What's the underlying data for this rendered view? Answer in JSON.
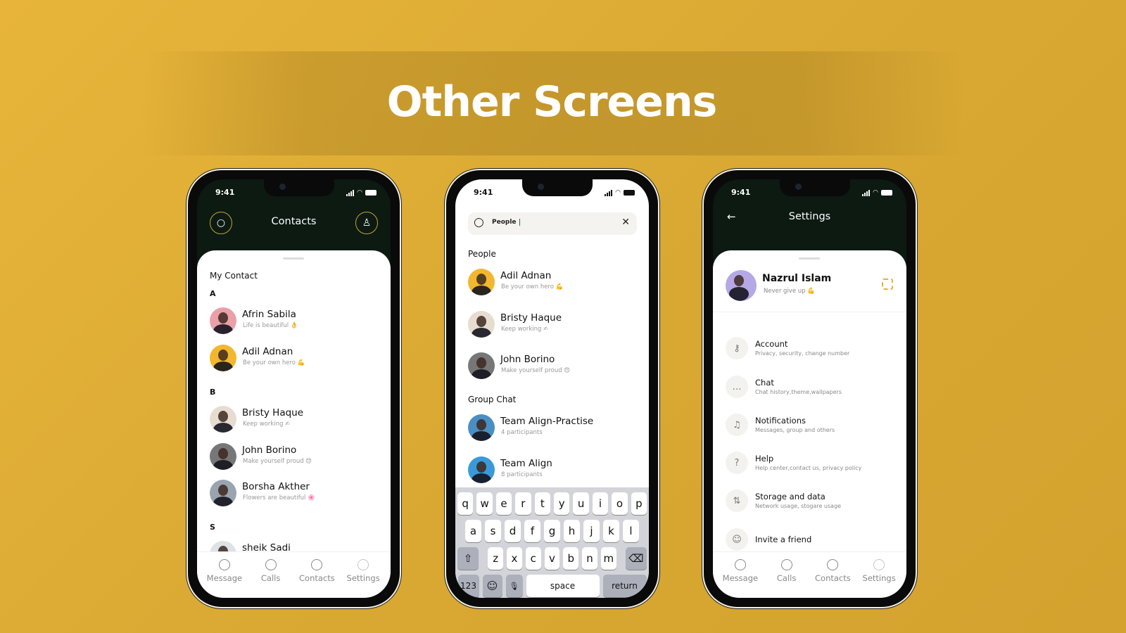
{
  "page_title": "Other Screens",
  "status_time": "9:41",
  "colors": {
    "accent": "#e8b032",
    "dark_header": "#0c1a12",
    "background": "#dcab35"
  },
  "nav_items": [
    {
      "label": "Message",
      "icon": "message-icon"
    },
    {
      "label": "Calls",
      "icon": "phone-icon"
    },
    {
      "label": "Contacts",
      "icon": "contact-icon"
    },
    {
      "label": "Settings",
      "icon": "gear-icon"
    }
  ],
  "contacts_screen": {
    "title": "Contacts",
    "active_nav": "Contacts",
    "section_label": "My Contact",
    "groups": [
      {
        "letter": "A",
        "contacts": [
          {
            "name": "Afrin Sabila",
            "status": "Life is beautiful 👌",
            "avatar_color": "#eaa0a8"
          },
          {
            "name": "Adil Adnan",
            "status": "Be your own hero 💪",
            "avatar_color": "#f2b72e"
          }
        ]
      },
      {
        "letter": "B",
        "contacts": [
          {
            "name": "Bristy Haque",
            "status": "Keep working ✍",
            "avatar_color": "#e6ddd0"
          },
          {
            "name": "John Borino",
            "status": "Make yourself proud 😍",
            "avatar_color": "#777777"
          },
          {
            "name": "Borsha Akther",
            "status": "Flowers are beautiful 🌸",
            "avatar_color": "#9aa4b0"
          }
        ]
      },
      {
        "letter": "S",
        "contacts": [
          {
            "name": "sheik Sadi",
            "status": "",
            "avatar_color": "#dde2e6"
          }
        ]
      }
    ]
  },
  "search_screen": {
    "search_value": "People",
    "people_label": "People",
    "people": [
      {
        "name": "Adil Adnan",
        "status": "Be your own hero 💪",
        "avatar_color": "#f2b72e"
      },
      {
        "name": "Bristy Haque",
        "status": "Keep working ✍",
        "avatar_color": "#e6ddd0"
      },
      {
        "name": "John Borino",
        "status": "Make yourself proud 😍",
        "avatar_color": "#777777"
      }
    ],
    "group_label": "Group Chat",
    "groups": [
      {
        "name": "Team Align-Practise",
        "status": "4 participants",
        "avatar_color": "#4a8fc4"
      },
      {
        "name": "Team Align",
        "status": "8 participants",
        "avatar_color": "#3a9ad8"
      }
    ],
    "keyboard": {
      "rows": [
        [
          "q",
          "w",
          "e",
          "r",
          "t",
          "y",
          "u",
          "i",
          "o",
          "p"
        ],
        [
          "a",
          "s",
          "d",
          "f",
          "g",
          "h",
          "j",
          "k",
          "l"
        ],
        [
          "z",
          "x",
          "c",
          "v",
          "b",
          "n",
          "m"
        ]
      ],
      "shift": "⇧",
      "backspace": "⌫",
      "numbers": "123",
      "emoji": "☺",
      "mic": "🎙",
      "space": "space",
      "return": "return"
    }
  },
  "settings_screen": {
    "title": "Settings",
    "active_nav": "Settings",
    "profile": {
      "name": "Nazrul Islam",
      "status": "Never give up 💪",
      "avatar_color": "#b4a8e6"
    },
    "items": [
      {
        "title": "Account",
        "subtitle": "Privacy, security, change number",
        "icon": "key-icon",
        "glyph": "⚷"
      },
      {
        "title": "Chat",
        "subtitle": "Chat history,theme,wallpapers",
        "icon": "chat-icon",
        "glyph": "…"
      },
      {
        "title": "Notifications",
        "subtitle": "Messages, group and others",
        "icon": "bell-icon",
        "glyph": "♫"
      },
      {
        "title": "Help",
        "subtitle": "Help center,contact us, privacy policy",
        "icon": "help-icon",
        "glyph": "?"
      },
      {
        "title": "Storage and data",
        "subtitle": "Network usage, stogare usage",
        "icon": "storage-icon",
        "glyph": "⇅"
      },
      {
        "title": "Invite a friend",
        "subtitle": "",
        "icon": "invite-icon",
        "glyph": "☺"
      }
    ]
  }
}
